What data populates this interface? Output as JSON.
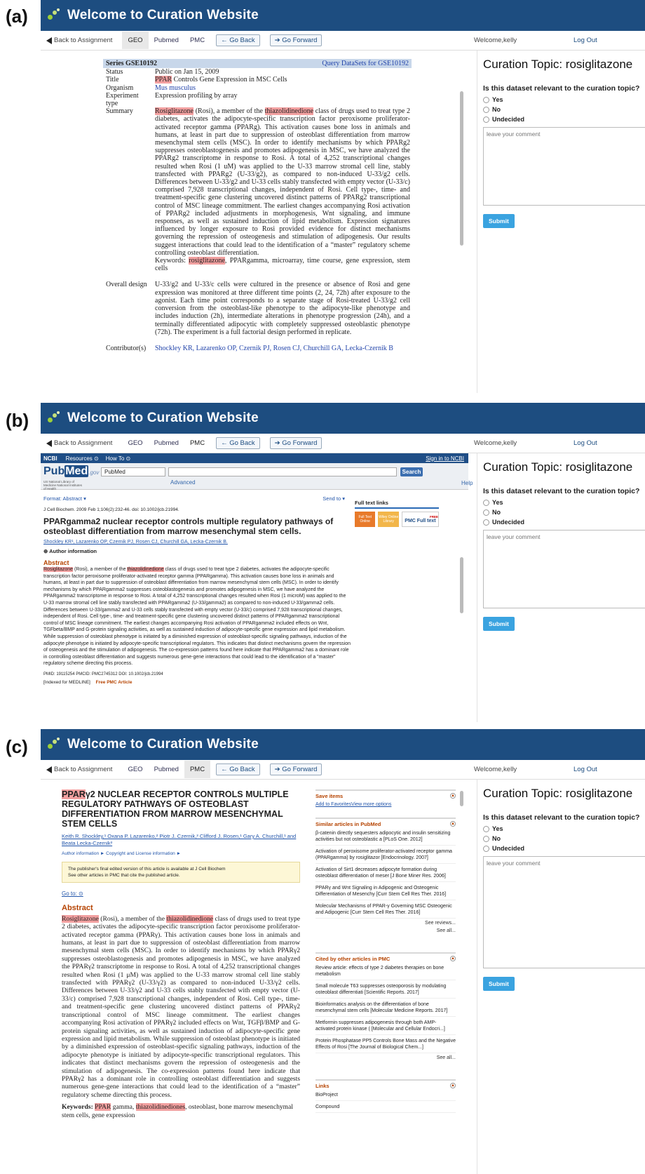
{
  "panels": {
    "a": "(a)",
    "b": "(b)",
    "c": "(c)"
  },
  "banner": {
    "title": "Welcome to Curation Website"
  },
  "nav": {
    "back": "Back to Assignment",
    "geo": "GEO",
    "pubmed": "Pubmed",
    "pmc": "PMC",
    "go_back": "← Go Back",
    "go_forward": "➔ Go Forward",
    "welcome": "Welcome,kelly",
    "logout": "Log Out"
  },
  "curation": {
    "topic": "Curation Topic: rosiglitazone",
    "question": "Is this dataset relevant to the curation topic?",
    "options": [
      "Yes",
      "No",
      "Undecided"
    ],
    "comment_placeholder": "leave your comment",
    "submit": "Submit"
  },
  "geo": {
    "series": "Series GSE10192",
    "query": "Query DataSets for GSE10192",
    "status_k": "Status",
    "status_v": "Public on Jan 15, 2009",
    "title_k": "Title",
    "title_hl": "PPAR",
    "title_v": " Controls Gene Expression in MSC Cells",
    "organism_k": "Organism",
    "organism_v": "Mus musculus",
    "exptype_k": "Experiment type",
    "exptype_v": "Expression profiling by array",
    "summary_k": "Summary",
    "summary_hl1": "Rosiglitazone",
    "summary_t1": " (Rosi), a member of the ",
    "summary_hl2": "thiazolidinedione",
    "summary_t2": " class of drugs used to treat type 2 diabetes, activates the adipocyte-specific transcription factor peroxisome proliferator-activated receptor gamma (PPARg). This activation causes bone loss in animals and humans, at least in part due to suppression of osteoblast differentiation from marrow mesenchymal stem cells (MSC). In order to identify mechanisms by which PPARg2 suppresses osteoblastogenesis and promotes adipogenesis in MSC, we have analyzed the PPARg2 transcriptome in response to Rosi. A total of 4,252 transcriptional changes resulted when Rosi (1 uM) was applied to the U-33 marrow stromal cell line, stably transfected with PPARg2 (U-33/g2), as compared to non-induced U-33/g2 cells. Differences between U-33/g2 and U-33 cells stably transfected with empty vector (U-33/c) comprised 7,928 transcriptional changes, independent of Rosi. Cell type-, time- and treatment-specific gene clustering uncovered distinct patterns of PPARg2 transcriptional control of MSC lineage commitment. The earliest changes accompanying Rosi activation of PPARg2 included adjustments in morphogenesis, Wnt signaling, and immune responses, as well as sustained induction of lipid metabolism. Expression signatures influenced by longer exposure to Rosi provided evidence for distinct mechanisms governing the repression of osteogenesis and stimulation of adipogenesis. Our results suggest interactions that could lead to the identification of a “master” regulatory scheme controlling osteoblast differentiation.",
    "kw_pre": "Keywords: ",
    "kw_hl": "rosiglitazone",
    "kw_post": ", PPARgamma, microarray, time course, gene expression, stem cells",
    "design_k": "Overall design",
    "design_v": "U-33/g2 and U-33/c cells were cultured in the presence or absence of Rosi and gene expression was monitored at three different time points (2, 24, 72h) after exposure to the agonist. Each time point corresponds to a separate stage of Rosi-treated U-33/g2 cell conversion from the osteoblast-like phenotype to the adipocyte-like phenotype and includes induction (2h), intermediate alterations in phenotype progression (24h), and a terminally differentiated adipocytic with completely suppressed osteoblastic phenotype (72h). The experiment is a full factorial design performed in replicate.",
    "contrib_k": "Contributor(s)",
    "contrib_v": "Shockley KR, Lazarenko OP, Czernik PJ, Rosen CJ, Churchill GA, Lecka-Czernik B"
  },
  "pubmed": {
    "ncbi": "NCBI",
    "resources": "Resources ⊙",
    "howto": "How To ⊙",
    "signin": "Sign in to NCBI",
    "logo_a": "Pub",
    "logo_b": "Med",
    "logo_c": ".gov",
    "logo_sub": "US National Library of Medicine National Institutes of Health",
    "db": "PubMed",
    "search": "Search",
    "advanced": "Advanced",
    "help": "Help",
    "format": "Format: Abstract ▾",
    "sendto": "Send to ▾",
    "citation": "J Cell Biochem. 2009 Feb 1;106(2):232-46. doi: 10.1002/jcb.21994.",
    "title": "PPARgamma2 nuclear receptor controls multiple regulatory pathways of osteoblast differentiation from marrow mesenchymal stem cells.",
    "authors": "Shockley KR¹, Lazarenko OP, Czernik PJ, Rosen CJ, Churchill GA, Lecka-Czernik B.",
    "author_info": "⊕ Author information",
    "abstract_h": "Abstract",
    "abs_hl1": "Rosiglitazone",
    "abs_t1": " (Rosi), a member of the ",
    "abs_hl2": "thiazolidinedione",
    "abs_t2": " class of drugs used to treat type 2 diabetes, activates the adipocyte-specific transcription factor peroxisome proliferator-activated receptor gamma (PPARgamma). This activation causes bone loss in animals and humans, at least in part due to suppression of osteoblast differentiation from marrow mesenchymal stem cells (MSC). In order to identify mechanisms by which PPARgamma2 suppresses osteoblastogenesis and promotes adipogenesis in MSC, we have analyzed the PPARgamma2 transcriptome in response to Rosi. A total of 4,252 transcriptional changes resulted when Rosi (1 microM) was applied to the U-33 marrow stromal cell line stably transfected with PPARgamma2 (U-33/gamma2) as compared to non-induced U-33/gamma2 cells. Differences between U-33/gamma2 and U-33 cells stably transfected with empty vector (U-33/c) comprised 7,928 transcriptional changes, independent of Rosi. Cell type-, time- and treatment-specific gene clustering uncovered distinct patterns of PPARgamma2 transcriptional control of MSC lineage commitment. The earliest changes accompanying Rosi activation of PPARgamma2 included effects on Wnt, TGFbeta/BMP and G-protein signaling activities, as well as sustained induction of adipocyte-specific gene expression and lipid metabolism. While suppression of osteoblast phenotype is initiated by a diminished expression of osteoblast-specific signaling pathways, induction of the adipocyte phenotype is initiated by adipocyte-specific transcriptional regulators. This indicates that distinct mechanisms govern the repression of osteogenesis and the stimulation of adipogenesis. The co-expression patterns found here indicate that PPARgamma2 has a dominant role in controlling osteoblast differentiation and suggests numerous gene-gene interactions that could lead to the identification of a \"master\" regulatory scheme directing this process.",
    "ids": "PMID: 19115254   PMCID: PMC2745312   DOI: 10.1002/jcb.21994",
    "indexed": "[Indexed for MEDLINE]",
    "free": "Free PMC Article",
    "fulltext": "Full text links",
    "ft1": "Full Text Online",
    "ft2": "Wiley Online Library",
    "ft_free": "FREE",
    "pmc_btn": "PMC Full text"
  },
  "pmc": {
    "title_hl": "PPAR",
    "title_t": "γ2 NUCLEAR RECEPTOR CONTROLS MULTIPLE REGULATORY PATHWAYS OF OSTEOBLAST DIFFERENTIATION FROM MARROW MESENCHYMAL STEM CELLS",
    "authors": "Keith R. Shockley,¹ Oxana P. Lazarenko,² Piotr J. Czernik,³ Clifford J. Rosen,¹ Gary A. Churchill,¹ and Beata Lecka-Czernik³",
    "author_info": "Author information ► Copyright and License information ►",
    "box1": "The publisher's final edited version of this article is available at J Cell Biochem",
    "box2": "See other articles in PMC that cite the published article.",
    "goto": "Go to: ⊙",
    "abstract_h": "Abstract",
    "abs_hl1": "Rosiglitazone",
    "abs_t1": " (Rosi), a member of the ",
    "abs_hl2": "thiazolidinedione",
    "abs_t2": " class of drugs used to treat type 2 diabetes, activates the adipocyte-specific transcription factor peroxisome proliferator-activated receptor gamma (PPARγ). This activation causes bone loss in animals and humans, at least in part due to suppression of osteoblast differentiation from marrow mesenchymal stem cells (MSC). In order to identify mechanisms by which PPARγ2 suppresses osteoblastogenesis and promotes adipogenesis in MSC, we have analyzed the PPARγ2 transcriptome in response to Rosi. A total of 4,252 transcriptional changes resulted when Rosi (1 μM) was applied to the U-33 marrow stromal cell line stably transfected with PPARγ2 (U-33/γ2) as compared to non-induced U-33/γ2 cells. Differences between U-33/γ2 and U-33 cells stably transfected with empty vector (U-33/c) comprised 7,928 transcriptional changes, independent of Rosi. Cell type-, time- and treatment-specific gene clustering uncovered distinct patterns of PPARγ2 transcriptional control of MSC lineage commitment. The earliest changes accompanying Rosi activation of PPARγ2 included effects on Wnt, TGFβ/BMP and G-protein signaling activities, as well as sustained induction of adipocyte-specific gene expression and lipid metabolism. While suppression of osteoblast phenotype is initiated by a diminished expression of osteoblast-specific signaling pathways, induction of the adipocyte phenotype is initiated by adipocyte-specific transcriptional regulators. This indicates that distinct mechanisms govern the repression of osteogenesis and the stimulation of adipogenesis. The co-expression patterns found here indicate that PPARγ2 has a dominant role in controlling osteoblast differentiation and suggests numerous gene-gene interactions that could lead to the identification of a “master” regulatory scheme directing this process.",
    "kw_pre": "Keywords: ",
    "kw_hl1": "PPAR",
    "kw_t1": " gamma, ",
    "kw_hl2": "thiazolidinediones",
    "kw_t2": ", osteoblast, bone marrow mesenchymal stem cells, gene expression",
    "save_h": "Save items",
    "save_l": "Add to FavoritesView more options",
    "similar_h": "Similar articles in PubMed",
    "similar": [
      "β-catenin directly sequesters adipocytic and insulin sensitizing activities but not osteoblastic a [PLoS One. 2012]",
      "Activation of peroxisome proliferator-activated receptor gamma (PPARgamma) by rosiglitazor [Endocrinology. 2007]",
      "Activation of Sirt1 decreases adipocyte formation during osteoblast differentiation of meser [J Bone Miner Res. 2006]",
      "PPARγ and Wnt Signaling in Adipogenic and Osteogenic Differentiation of Mesenchy [Curr Stem Cell Res Ther. 2016]",
      "Molecular Mechanisms of PPAR-γ Governing MSC Osteogenic and Adipogenic [Curr Stem Cell Res Ther. 2016]"
    ],
    "see_reviews": "See reviews...",
    "see_all": "See all...",
    "cited_h": "Cited by other articles in PMC",
    "cited": [
      "Review article: effects of type 2 diabetes therapies on bone metabolism",
      "Small molecule T63 suppresses osteoporosis by modulating osteoblast differentiati [Scientific Reports. 2017]",
      "Bioinformatics analysis on the differentiation of bone mesenchymal stem cells [Molecular Medicine Reports. 2017]",
      "Metformin suppresses adipogenesis through both AMP-activated protein kinase ( [Molecular and Cellular Endocri...]",
      "Protein Phosphatase PP5 Controls Bone Mass and the Negative Effects of Rosi [The Journal of Biological Chem...]"
    ],
    "links_h": "Links",
    "links": [
      "BioProject",
      "Compound"
    ]
  }
}
